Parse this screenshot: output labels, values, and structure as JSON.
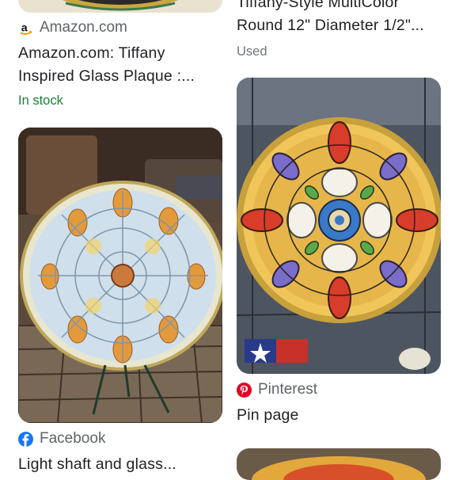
{
  "results": [
    {
      "source": "Amazon.com",
      "source_icon": "amazon-logo-icon",
      "title_line1": "Amazon.com: Tiffany",
      "title_line2": "Inspired Glass Plaque :...",
      "status": "In stock",
      "status_color": "#188038"
    },
    {
      "source": "Facebook",
      "source_icon": "facebook-logo-icon",
      "title_line1": "Light shaft and glass..."
    },
    {
      "title_line1": "Tiffany-Style MultiColor",
      "title_line2": "Round 12\" Diameter 1/2\"...",
      "status": "Used",
      "status_color": "#70757a"
    },
    {
      "source": "Pinterest",
      "source_icon": "pinterest-logo-icon",
      "title_line1": "Pin page"
    }
  ],
  "colors": {
    "title_text": "#202124",
    "source_text": "#5f6368",
    "facebook_blue": "#1877f2",
    "pinterest_red": "#e60023"
  }
}
